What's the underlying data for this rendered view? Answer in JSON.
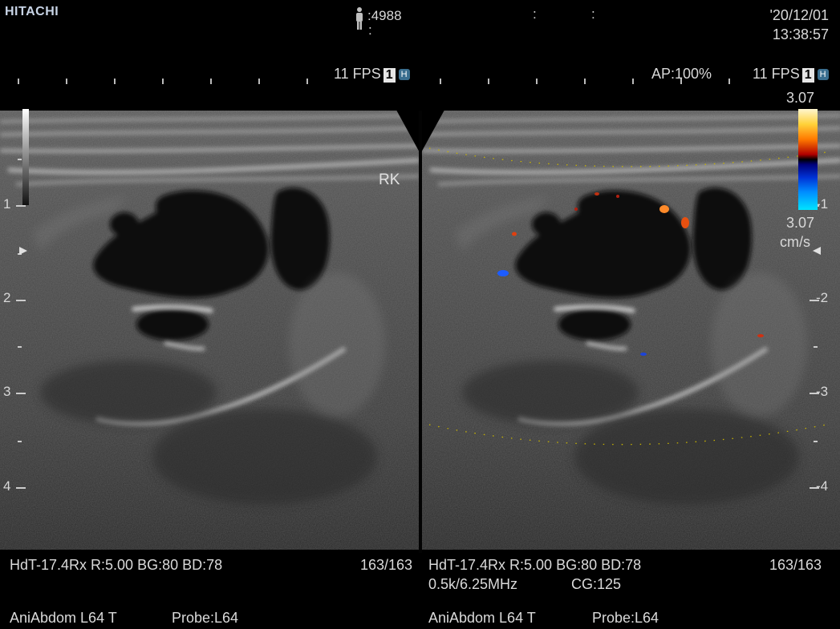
{
  "header": {
    "brand": "HITACHI",
    "patient_id": ":4988",
    "patient_colon": ":",
    "mid_colons": [
      ":",
      ":"
    ],
    "date": "'20/12/01",
    "time": "13:38:57",
    "left_fps": "11 FPS",
    "right_fps": "11 FPS",
    "fps_badge": "1",
    "fps_badge_h": "H",
    "acoustic_power": "AP:100%"
  },
  "images": {
    "annotation": "RK",
    "left_depth_labels": [
      "1",
      "2",
      "3",
      "4"
    ],
    "right_depth_labels": [
      "-1",
      "-2",
      "-3",
      "-4"
    ]
  },
  "color_scale": {
    "top": "3.07",
    "bottom": "3.07",
    "unit": "cm/s"
  },
  "footer": {
    "left_params": "HdT-17.4Rx  R:5.00  BG:80  BD:78",
    "left_frames": "163/163",
    "right_params": "HdT-17.4Rx  R:5.00  BG:80  BD:78",
    "right_frames": "163/163",
    "doppler_freq": "0.5k/6.25MHz",
    "color_gain": "CG:125",
    "left_preset": "AniAbdom L64 T",
    "left_probe": "Probe:L64",
    "right_preset": "AniAbdom L64 T",
    "right_probe": "Probe:L64"
  },
  "colors": {
    "brand": "#c8d4e6",
    "doppler_red": "#e04010",
    "doppler_blue": "#1c5cff",
    "roi_dots": "#c8b400"
  }
}
